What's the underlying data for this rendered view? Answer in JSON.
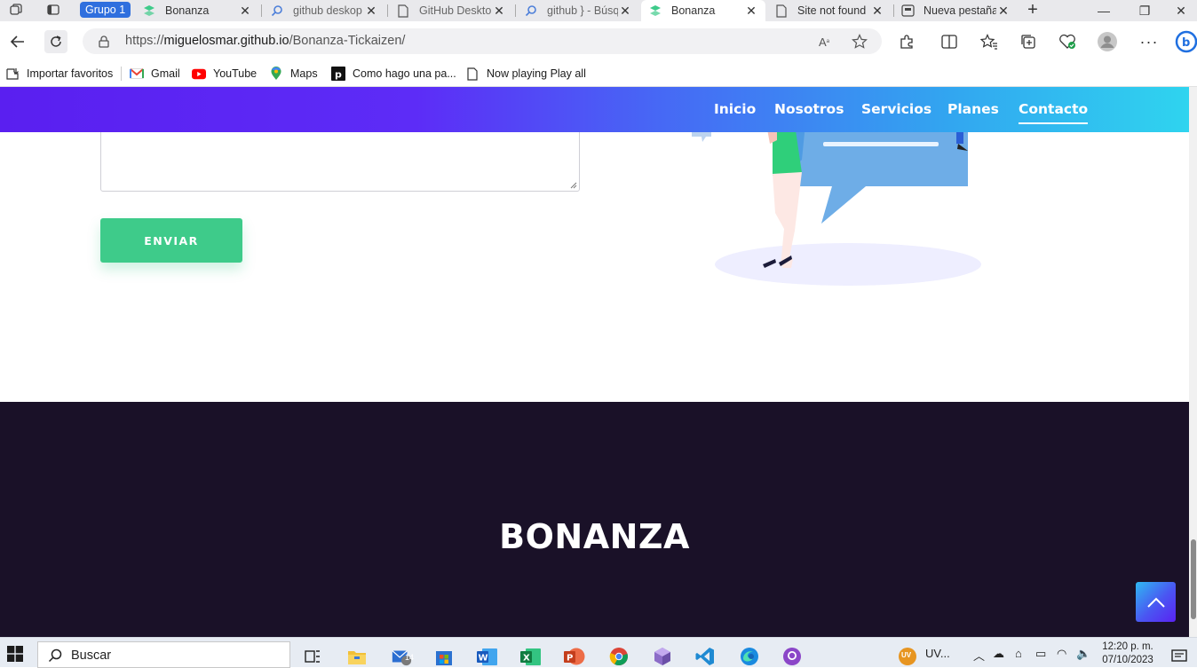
{
  "browser": {
    "tab_group_label": "Grupo 1",
    "tabs": [
      {
        "title": "Bonanza",
        "icon": "bonanza-logo-icon",
        "active": false
      },
      {
        "title": "github deskop",
        "icon": "search-icon",
        "active": false
      },
      {
        "title": "GitHub Deskto",
        "icon": "page-icon",
        "active": false
      },
      {
        "title": "github } - Búsq",
        "icon": "search-icon",
        "active": false
      },
      {
        "title": "Bonanza",
        "icon": "bonanza-logo-icon",
        "active": true
      },
      {
        "title": "Site not found",
        "icon": "page-icon",
        "active": false
      },
      {
        "title": "Nueva pestaña",
        "icon": "new-tab-icon",
        "active": false
      }
    ],
    "url_prefix": "https://",
    "url_host": "miguelosmar.github.io",
    "url_path": "/Bonanza-Tickaizen/",
    "favorites": [
      {
        "label": "Importar favoritos",
        "icon": "import-favorites-icon"
      },
      {
        "label": "Gmail",
        "icon": "gmail-icon"
      },
      {
        "label": "YouTube",
        "icon": "youtube-icon"
      },
      {
        "label": "Maps",
        "icon": "maps-icon"
      },
      {
        "label": "Como hago una pa...",
        "icon": "p-logo-icon"
      },
      {
        "label": "Now playing Play all",
        "icon": "page-icon"
      }
    ]
  },
  "page": {
    "nav": {
      "links": [
        "Inicio",
        "Nosotros",
        "Servicios",
        "Planes",
        "Contacto"
      ],
      "current": "Contacto"
    },
    "form": {
      "send_label": "ENVIAR"
    },
    "footer": {
      "brand": "BONANZA"
    },
    "colors": {
      "send_button": "#3ecb8a",
      "footer_bg": "#1a1128",
      "nav_gradient_start": "#5a1ff0",
      "nav_gradient_end": "#2fd4ef"
    }
  },
  "taskbar": {
    "search_label": "Buscar",
    "mail_badge": "14",
    "profile_initials": "UV",
    "profile_label": "UV...",
    "clock_time": "12:20 p. m.",
    "clock_date": "07/10/2023"
  }
}
